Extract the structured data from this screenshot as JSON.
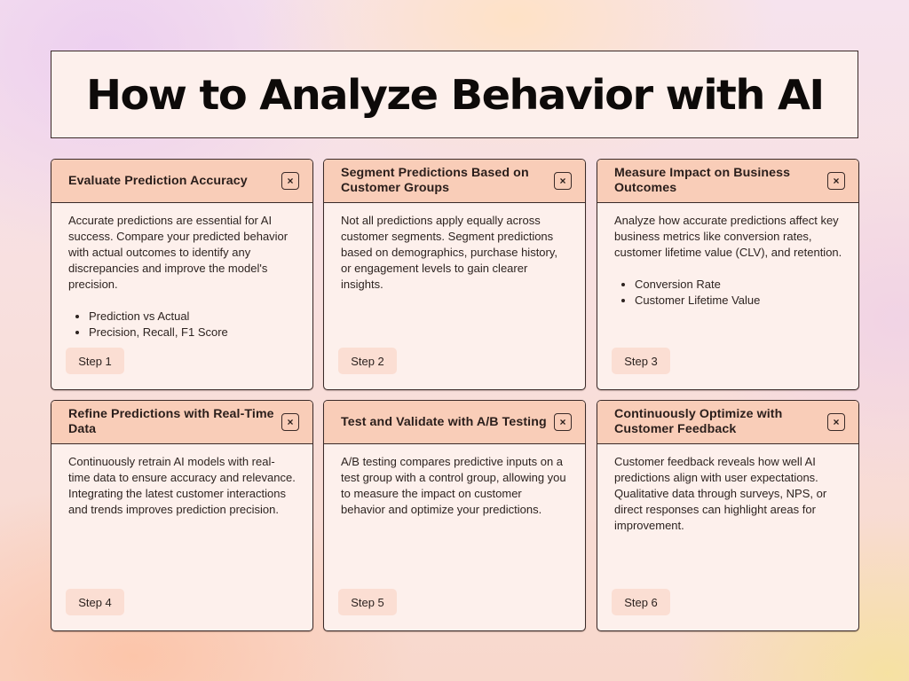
{
  "page": {
    "title": "How to Analyze Behavior with AI"
  },
  "cards": [
    {
      "title": "Evaluate Prediction Accuracy",
      "close_icon": "×",
      "body": "Accurate predictions are essential for AI success. Compare your predicted behavior with actual outcomes to identify any discrepancies and improve the model's precision.",
      "bullets": [
        "Prediction vs Actual",
        "Precision, Recall, F1 Score"
      ],
      "step": "Step 1"
    },
    {
      "title": "Segment Predictions Based on Customer Groups",
      "close_icon": "×",
      "body": "Not all predictions apply equally across customer segments. Segment predictions based on demographics, purchase history, or engagement levels to gain clearer insights.",
      "bullets": [],
      "step": "Step 2"
    },
    {
      "title": "Measure Impact on Business Outcomes",
      "close_icon": "×",
      "body": "Analyze how accurate predictions affect key business metrics like conversion rates, customer lifetime value (CLV), and retention.",
      "bullets": [
        "Conversion Rate",
        "Customer Lifetime Value"
      ],
      "step": "Step 3"
    },
    {
      "title": "Refine Predictions with Real-Time Data",
      "close_icon": "×",
      "body": "Continuously retrain AI models with real-time data to ensure accuracy and relevance. Integrating the latest customer interactions and trends improves prediction precision.",
      "bullets": [],
      "step": "Step 4"
    },
    {
      "title": "Test and Validate with A/B Testing",
      "close_icon": "×",
      "body": "A/B testing compares predictive inputs on a test group with a control group, allowing you to measure the impact on customer behavior and optimize your predictions.",
      "bullets": [],
      "step": "Step 5"
    },
    {
      "title": "Continuously Optimize with Customer Feedback",
      "close_icon": "×",
      "body": "Customer feedback reveals how well AI predictions align with user expectations. Qualitative data through surveys, NPS, or direct responses can highlight areas for improvement.",
      "bullets": [],
      "step": "Step 6"
    }
  ],
  "colors": {
    "header_bg": "#f9cdb8",
    "card_bg": "#fdf0ec",
    "badge_bg": "#fbded3",
    "border": "#3a2a28"
  }
}
